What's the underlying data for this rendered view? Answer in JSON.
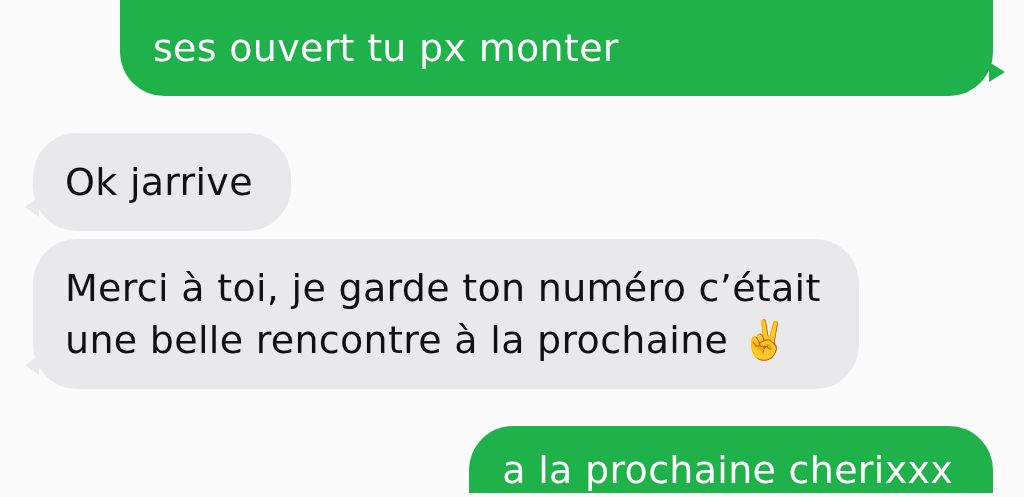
{
  "messages": [
    {
      "kind": "outgoing",
      "text": "ses ouvert tu px monter"
    },
    {
      "kind": "incoming",
      "text": "Ok jarrive"
    },
    {
      "kind": "incoming",
      "text": "Merci à toi, je garde ton numéro c’était\nune belle rencontre à la prochaine ✌️"
    },
    {
      "kind": "outgoing",
      "text": "a la prochaine cherixxx"
    }
  ]
}
